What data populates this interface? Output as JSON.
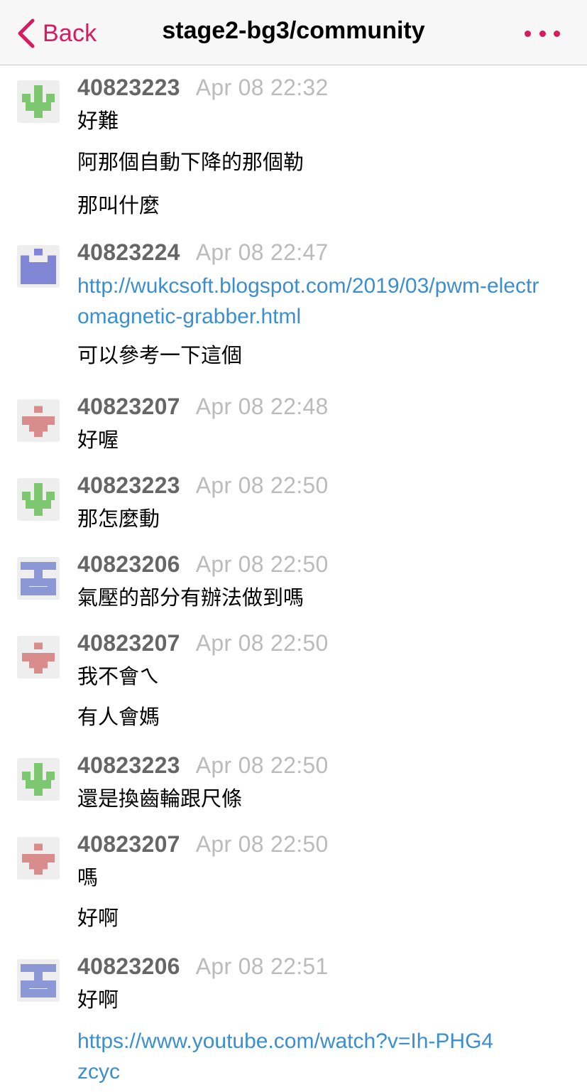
{
  "nav": {
    "back_label": "Back",
    "title": "stage2-bg3/community",
    "accent_color": "#d81b60"
  },
  "messages": [
    {
      "user": "40823223",
      "time": "Apr 08 22:32",
      "avatar": "green-identicon",
      "lines": [
        "好難",
        "阿那個自動下降的那個勒",
        "那叫什麼"
      ]
    },
    {
      "user": "40823224",
      "time": "Apr 08 22:47",
      "avatar": "indigo-identicon",
      "link": "http://wukcsoft.blogspot.com/2019/03/pwm-electromagnetic-grabber.html",
      "lines": [
        "可以參考一下這個"
      ]
    },
    {
      "user": "40823207",
      "time": "Apr 08 22:48",
      "avatar": "rose-identicon",
      "lines": [
        "好喔"
      ]
    },
    {
      "user": "40823223",
      "time": "Apr 08 22:50",
      "avatar": "green-identicon",
      "lines": [
        "那怎麼動"
      ]
    },
    {
      "user": "40823206",
      "time": "Apr 08 22:50",
      "avatar": "periwinkle-identicon",
      "lines": [
        "氣壓的部分有辦法做到嗎"
      ]
    },
    {
      "user": "40823207",
      "time": "Apr 08 22:50",
      "avatar": "rose-identicon",
      "lines": [
        "我不會ㄟ",
        "有人會媽"
      ]
    },
    {
      "user": "40823223",
      "time": "Apr 08 22:50",
      "avatar": "green-identicon",
      "lines": [
        "還是換齒輪跟尺條"
      ]
    },
    {
      "user": "40823207",
      "time": "Apr 08 22:50",
      "avatar": "rose-identicon",
      "lines": [
        "嗎",
        "好啊"
      ]
    },
    {
      "user": "40823206",
      "time": "Apr 08 22:51",
      "avatar": "periwinkle-identicon",
      "lines": [
        "好啊"
      ],
      "link_after": "https://www.youtube.com/watch?v=Ih-PHG4zcyc"
    }
  ],
  "colors": {
    "green-identicon": "#7dc770",
    "indigo-identicon": "#8085d6",
    "rose-identicon": "#d98c8c",
    "periwinkle-identicon": "#8c98d6",
    "username": "#666666",
    "timestamp": "#bbbbbb",
    "link": "#3b8fd1"
  }
}
